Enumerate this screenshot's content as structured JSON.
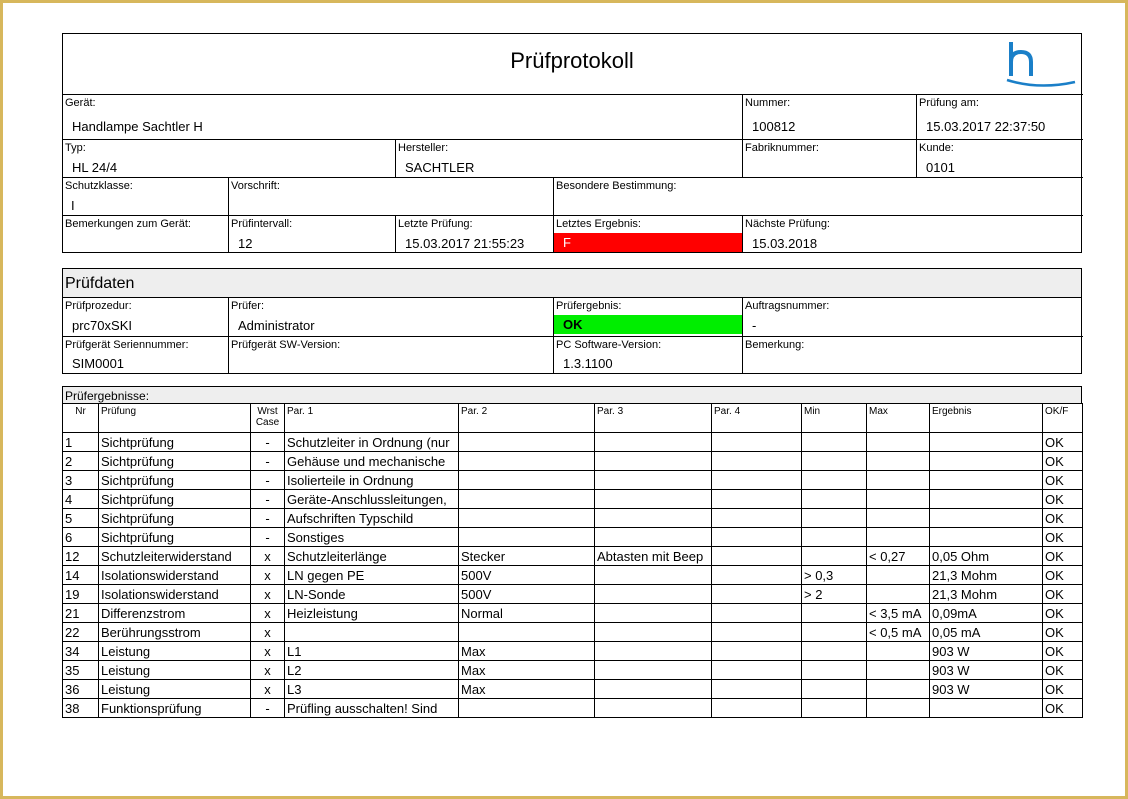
{
  "header": {
    "title": "Prüfprotokoll"
  },
  "device": {
    "geraet_label": "Gerät:",
    "geraet_value": "Handlampe Sachtler H",
    "nummer_label": "Nummer:",
    "nummer_value": "100812",
    "pruefung_am_label": "Prüfung am:",
    "pruefung_am_value": "15.03.2017 22:37:50",
    "typ_label": "Typ:",
    "typ_value": "HL 24/4",
    "hersteller_label": "Hersteller:",
    "hersteller_value": "SACHTLER",
    "fabriknummer_label": "Fabriknummer:",
    "fabriknummer_value": "",
    "kunde_label": "Kunde:",
    "kunde_value": "0101",
    "schutzklasse_label": "Schutzklasse:",
    "schutzklasse_value": "I",
    "vorschrift_label": "Vorschrift:",
    "vorschrift_value": "",
    "besondere_label": "Besondere Bestimmung:",
    "besondere_value": "",
    "bemerkungen_label": "Bemerkungen zum Gerät:",
    "bemerkungen_value": "",
    "intervall_label": "Prüfintervall:",
    "intervall_value": "12",
    "letzte_label": "Letzte Prüfung:",
    "letzte_value": "15.03.2017 21:55:23",
    "ergebnis_label": "Letztes Ergebnis:",
    "ergebnis_value": "F",
    "naechste_label": "Nächste Prüfung:",
    "naechste_value": "15.03.2018"
  },
  "pruefdaten": {
    "heading": "Prüfdaten",
    "prozedur_label": "Prüfprozedur:",
    "prozedur_value": "prc70xSKI",
    "pruefer_label": "Prüfer:",
    "pruefer_value": "Administrator",
    "ergebnis_label": "Prüfergebnis:",
    "ergebnis_value": "OK",
    "auftrag_label": "Auftragsnummer:",
    "auftrag_value": "-",
    "serien_label": "Prüfgerät Seriennummer:",
    "serien_value": "SIM0001",
    "sw_label": "Prüfgerät SW-Version:",
    "sw_value": "",
    "pc_label": "PC Software-Version:",
    "pc_value": "1.3.1100",
    "bemerkung_label": "Bemerkung:",
    "bemerkung_value": ""
  },
  "results": {
    "heading": "Prüfergebnisse:",
    "columns": [
      "Nr",
      "Prüfung",
      "Wrst Case",
      "Par. 1",
      "Par. 2",
      "Par. 3",
      "Par. 4",
      "Min",
      "Max",
      "Ergebnis",
      "OK/F"
    ],
    "rows": [
      [
        "1",
        "Sichtprüfung",
        "-",
        "Schutzleiter in Ordnung (nur",
        "",
        "",
        "",
        "",
        "",
        "",
        "OK"
      ],
      [
        "2",
        "Sichtprüfung",
        "-",
        "Gehäuse und mechanische",
        "",
        "",
        "",
        "",
        "",
        "",
        "OK"
      ],
      [
        "3",
        "Sichtprüfung",
        "-",
        "Isolierteile in Ordnung",
        "",
        "",
        "",
        "",
        "",
        "",
        "OK"
      ],
      [
        "4",
        "Sichtprüfung",
        "-",
        "Geräte-Anschlussleitungen,",
        "",
        "",
        "",
        "",
        "",
        "",
        "OK"
      ],
      [
        "5",
        "Sichtprüfung",
        "-",
        "Aufschriften Typschild",
        "",
        "",
        "",
        "",
        "",
        "",
        "OK"
      ],
      [
        "6",
        "Sichtprüfung",
        "-",
        "Sonstiges",
        "",
        "",
        "",
        "",
        "",
        "",
        "OK"
      ],
      [
        "12",
        "Schutzleiterwiderstand",
        "x",
        "Schutzleiterlänge",
        "Stecker",
        "Abtasten mit Beep",
        "",
        "",
        "< 0,27",
        "0,05 Ohm",
        "OK"
      ],
      [
        "14",
        "Isolationswiderstand",
        "x",
        "LN gegen PE",
        "500V",
        "",
        "",
        "> 0,3",
        "",
        "21,3 Mohm",
        "OK"
      ],
      [
        "19",
        "Isolationswiderstand",
        "x",
        "LN-Sonde",
        "500V",
        "",
        "",
        "> 2",
        "",
        "21,3 Mohm",
        "OK"
      ],
      [
        "21",
        "Differenzstrom",
        "x",
        "Heizleistung",
        "Normal",
        "",
        "",
        "",
        "< 3,5 mA",
        "0,09mA",
        "OK"
      ],
      [
        "22",
        "Berührungsstrom",
        "x",
        "",
        "",
        "",
        "",
        "",
        "< 0,5 mA",
        "0,05 mA",
        "OK"
      ],
      [
        "34",
        "Leistung",
        "x",
        "L1",
        "Max",
        "",
        "",
        "",
        "",
        "903 W",
        "OK"
      ],
      [
        "35",
        "Leistung",
        "x",
        "L2",
        "Max",
        "",
        "",
        "",
        "",
        "903 W",
        "OK"
      ],
      [
        "36",
        "Leistung",
        "x",
        "L3",
        "Max",
        "",
        "",
        "",
        "",
        "903 W",
        "OK"
      ],
      [
        "38",
        "Funktionsprüfung",
        "-",
        "Prüfling ausschalten! Sind",
        "",
        "",
        "",
        "",
        "",
        "",
        "OK"
      ]
    ]
  },
  "colors": {
    "frame": "#d7b75c",
    "fail": "#ff0000",
    "pass": "#00ee00",
    "logo": "#1a7fc8",
    "header_fill": "#eeeeee"
  },
  "logo": {
    "icon": "h-logo-icon"
  }
}
